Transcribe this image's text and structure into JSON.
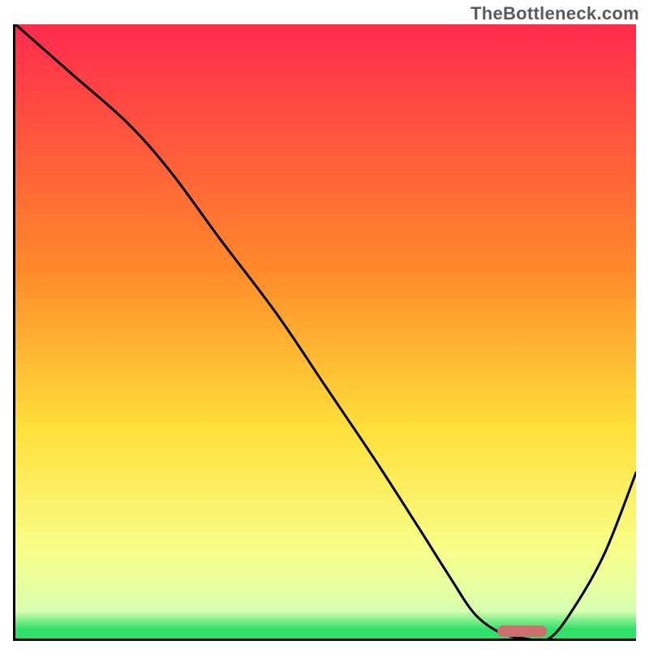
{
  "watermark": "TheBottleneck.com",
  "colors": {
    "gradient_top": "#ff2a4d",
    "gradient_mid_top": "#ff8a2a",
    "gradient_mid": "#ffe03a",
    "gradient_mid_bottom": "#f7ff8a",
    "gradient_green": "#2fe06a",
    "curve": "#000000",
    "marker": "#cf6e6e",
    "axis": "#000000"
  },
  "chart_data": {
    "type": "line",
    "title": "",
    "xlabel": "",
    "ylabel": "",
    "xlim": [
      0,
      100
    ],
    "ylim": [
      0,
      100
    ],
    "x": [
      0,
      9,
      18,
      25,
      33,
      42,
      50,
      58,
      65,
      70,
      74,
      78,
      82,
      86,
      90,
      95,
      100
    ],
    "values": [
      100,
      92,
      84,
      76,
      65,
      53,
      41,
      29,
      18,
      10,
      4,
      1,
      0,
      0,
      5,
      14,
      27
    ],
    "marker": {
      "x_start": 78,
      "x_end": 86,
      "y": 0
    },
    "gradient_stops": [
      {
        "pos": 0.0,
        "color": "#ff2a4d"
      },
      {
        "pos": 0.4,
        "color": "#ff8a2a"
      },
      {
        "pos": 0.66,
        "color": "#ffe03a"
      },
      {
        "pos": 0.86,
        "color": "#f7ff8a"
      },
      {
        "pos": 0.955,
        "color": "#d9ffb0"
      },
      {
        "pos": 0.985,
        "color": "#2fe06a"
      },
      {
        "pos": 1.0,
        "color": "#2fe06a"
      }
    ]
  }
}
